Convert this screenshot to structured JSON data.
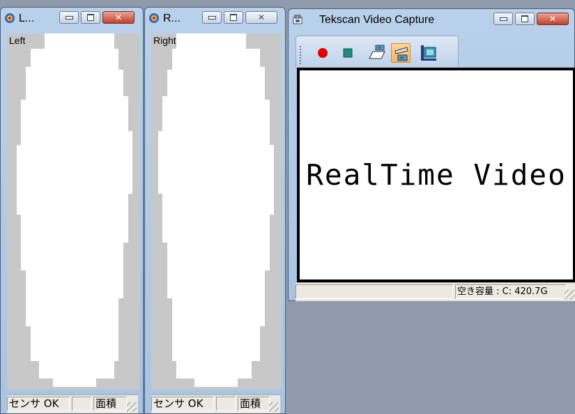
{
  "windows": {
    "left": {
      "title": "L...",
      "label": "Left",
      "status": {
        "sensor": "センサ OK",
        "empty": "",
        "area": "面積"
      }
    },
    "right": {
      "title": "R...",
      "label": "Right",
      "status": {
        "sensor": "センサ OK",
        "empty": "",
        "area": "面積"
      }
    },
    "video": {
      "title": "Tekscan Video Capture",
      "toolbar": {
        "buttons": [
          "record",
          "stop",
          "open-folder",
          "camera",
          "film"
        ]
      },
      "video_text": "RealTime Video",
      "status": {
        "left": "",
        "disk": "空き容量 :  C: 420.7G"
      }
    }
  },
  "colors": {
    "desktop": "#8f9aac",
    "sensor_bg": "#c8c8c8",
    "foot_area": "#ffffff",
    "record_red": "#e00000",
    "stop_teal": "#1d8a7a",
    "close_red": "#c3402a"
  }
}
